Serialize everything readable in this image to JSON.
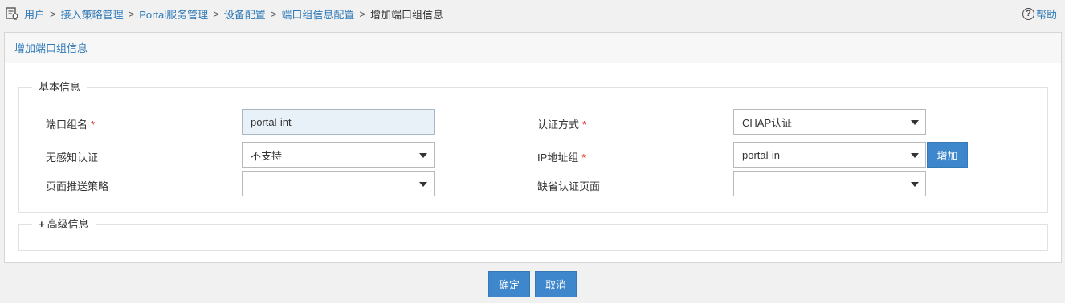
{
  "breadcrumb": {
    "items": [
      "用户",
      "接入策略管理",
      "Portal服务管理",
      "设备配置",
      "端口组信息配置"
    ],
    "separator": ">",
    "current": "增加端口组信息"
  },
  "help_label": "帮助",
  "panel": {
    "title": "增加端口组信息",
    "basic_legend": "基本信息",
    "advanced_legend": "高级信息"
  },
  "form": {
    "port_group_name": {
      "label": "端口组名",
      "required": "*",
      "value": "portal-int"
    },
    "auth_method": {
      "label": "认证方式",
      "required": "*",
      "value": "CHAP认证"
    },
    "seamless_auth": {
      "label": "无感知认证",
      "value": "不支持"
    },
    "ip_group": {
      "label": "IP地址组",
      "required": "*",
      "value": "portal-in",
      "add_label": "增加"
    },
    "page_push_policy": {
      "label": "页面推送策略",
      "value": ""
    },
    "default_auth_page": {
      "label": "缺省认证页面",
      "value": ""
    }
  },
  "actions": {
    "ok": "确定",
    "cancel": "取消"
  },
  "colors": {
    "accent": "#3f87cc",
    "link": "#2f7ab8",
    "required": "#d9261c"
  }
}
